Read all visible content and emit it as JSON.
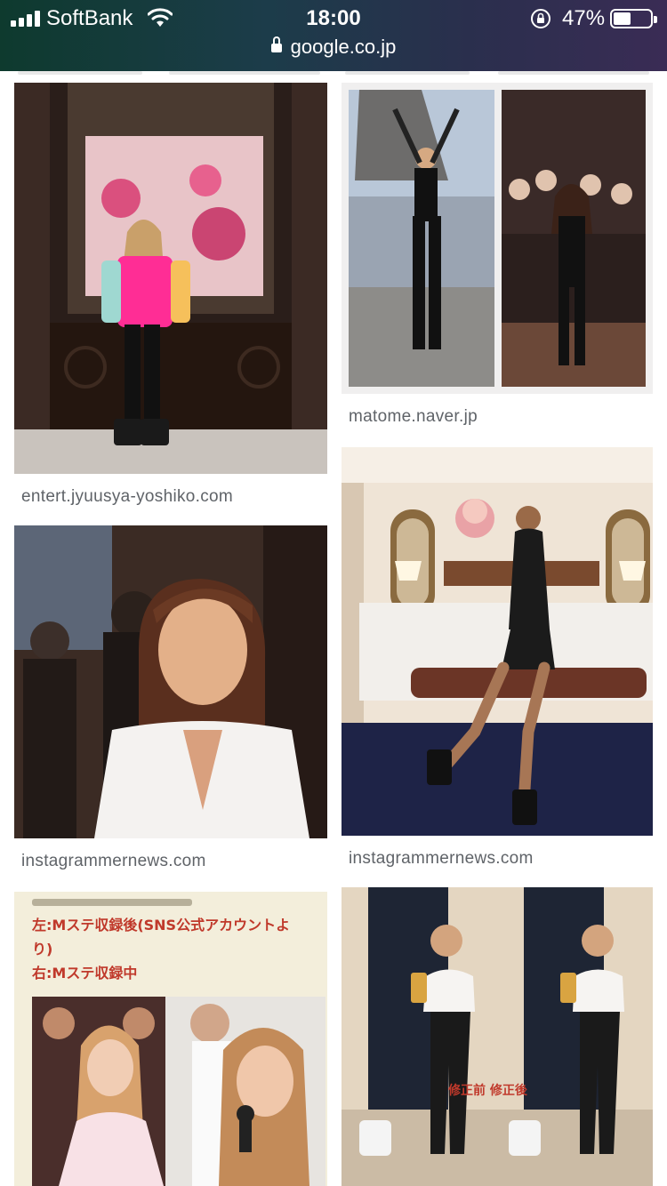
{
  "status_bar": {
    "carrier": "SoftBank",
    "time": "18:00",
    "battery_percent": "47%",
    "battery_level": 0.47
  },
  "address_bar": {
    "url": "google.co.jp"
  },
  "results": [
    {
      "source": "entert.jyuusya-yoshiko.com"
    },
    {
      "source": "matome.naver.jp"
    },
    {
      "source": "instagrammernews.com"
    },
    {
      "source": "instagrammernews.com"
    },
    {
      "caption_lines": [
        "左:Mステ収録後(SNS公式アカウントよ",
        "り)",
        "右:Mステ収録中"
      ]
    },
    {
      "caption_lines": [
        "修正前 修正後"
      ]
    }
  ],
  "colors": {
    "status_bar_gradient_start": "#0e3a2e",
    "status_bar_gradient_end": "#3a2c55",
    "source_text": "#5f6368",
    "caption_red": "#c0392b"
  }
}
